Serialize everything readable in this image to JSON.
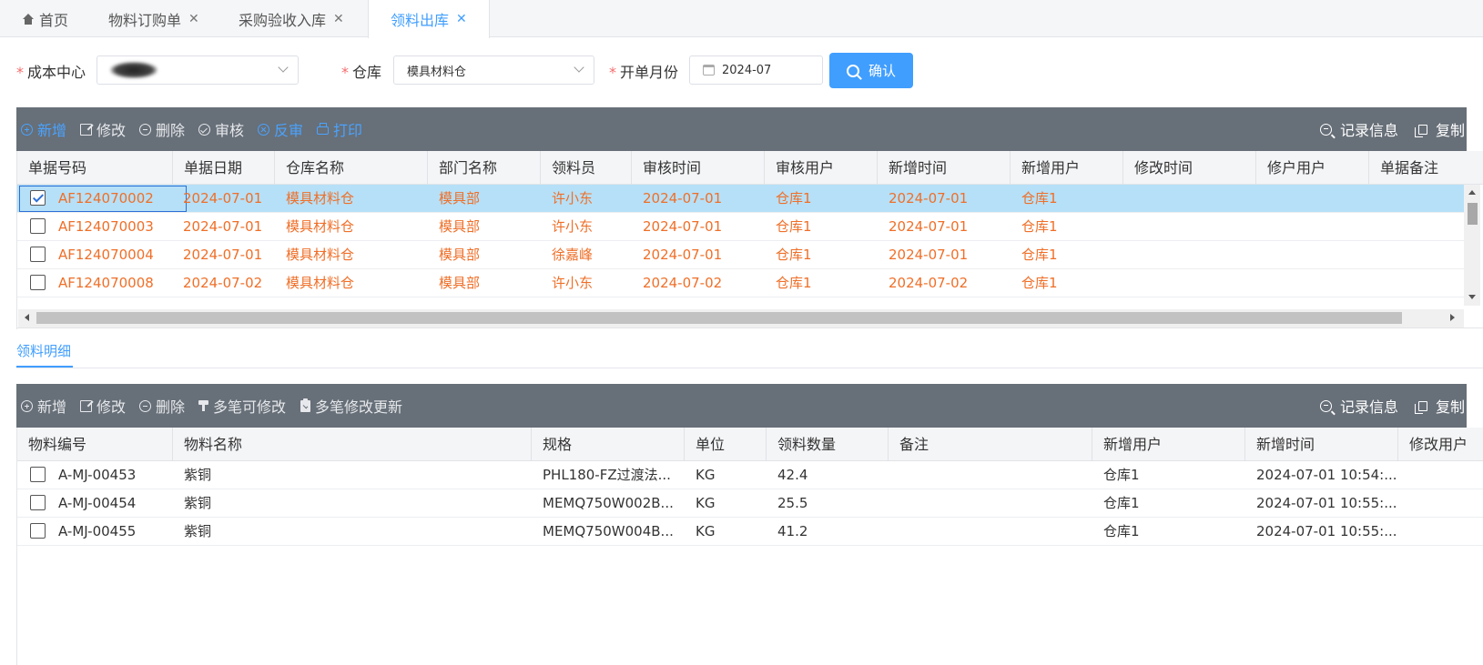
{
  "tabs": [
    {
      "label": "首页",
      "closable": false,
      "active": false
    },
    {
      "label": "物料订购单",
      "closable": true,
      "active": false
    },
    {
      "label": "采购验收入库",
      "closable": true,
      "active": false
    },
    {
      "label": "领料出库",
      "closable": true,
      "active": true
    }
  ],
  "close_glyph": "✕",
  "filters": {
    "cost_center_label": "成本中心",
    "warehouse_label": "仓库",
    "warehouse_value": "模具材料仓",
    "month_label": "开单月份",
    "month_value": "2024-07",
    "required_mark": "*",
    "confirm_label": "确认"
  },
  "toolbar_top": {
    "add": "新增",
    "edit": "修改",
    "delete": "删除",
    "audit": "审核",
    "unaudit": "反审",
    "print": "打印",
    "record_info": "记录信息",
    "copy": "复制"
  },
  "master_table": {
    "columns": [
      "单据号码",
      "单据日期",
      "仓库名称",
      "部门名称",
      "领料员",
      "审核时间",
      "审核用户",
      "新增时间",
      "新增用户",
      "修改时间",
      "修户用户",
      "单据备注"
    ],
    "rows": [
      [
        "AF124070002",
        "2024-07-01",
        "模具材料仓",
        "模具部",
        "许小东",
        "2024-07-01",
        "仓库1",
        "2024-07-01",
        "仓库1"
      ],
      [
        "AF124070003",
        "2024-07-01",
        "模具材料仓",
        "模具部",
        "许小东",
        "2024-07-01",
        "仓库1",
        "2024-07-01",
        "仓库1"
      ],
      [
        "AF124070004",
        "2024-07-01",
        "模具材料仓",
        "模具部",
        "徐嘉峰",
        "2024-07-01",
        "仓库1",
        "2024-07-01",
        "仓库1"
      ],
      [
        "AF124070008",
        "2024-07-02",
        "模具材料仓",
        "模具部",
        "许小东",
        "2024-07-02",
        "仓库1",
        "2024-07-02",
        "仓库1"
      ]
    ]
  },
  "detail_tab": "领料明细",
  "toolbar_bottom": {
    "add": "新增",
    "edit": "修改",
    "delete": "删除",
    "multi_edit": "多笔可修改",
    "multi_update": "多笔修改更新",
    "record_info": "记录信息",
    "copy": "复制"
  },
  "detail_table": {
    "columns": [
      "物料编号",
      "物料名称",
      "规格",
      "单位",
      "领料数量",
      "备注",
      "新增用户",
      "新增时间",
      "修改用户"
    ],
    "rows": [
      [
        "A-MJ-00453",
        "紫铜",
        "PHL180-FZ过渡法...",
        "KG",
        "42.4",
        "",
        "仓库1",
        "2024-07-01 10:54:..."
      ],
      [
        "A-MJ-00454",
        "紫铜",
        "MEMQ750W002B...",
        "KG",
        "25.5",
        "",
        "仓库1",
        "2024-07-01 10:55:..."
      ],
      [
        "A-MJ-00455",
        "紫铜",
        "MEMQ750W004B...",
        "KG",
        "41.2",
        "",
        "仓库1",
        "2024-07-01 10:55:..."
      ]
    ]
  },
  "colors": {
    "accent": "#409eff",
    "toolbar": "#676f78",
    "row_text": "#ef6f28",
    "selected_row": "#b6e0f7"
  }
}
